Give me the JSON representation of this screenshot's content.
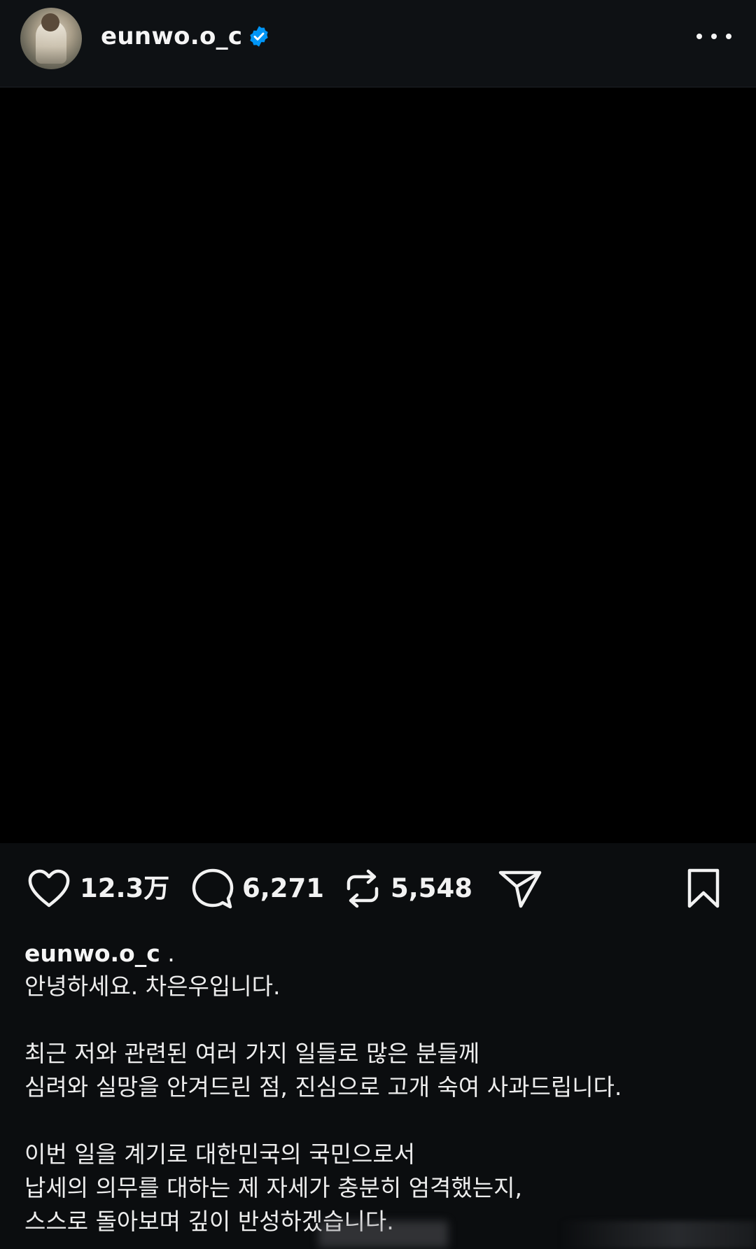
{
  "header": {
    "username": "eunwo.o_c",
    "verified": true,
    "more_icon": "more-horizontal-icon"
  },
  "media": {
    "background": "#000000"
  },
  "actions": {
    "like_count": "12.3万",
    "comment_count": "6,271",
    "repost_count": "5,548",
    "icons": [
      "heart-icon",
      "comment-icon",
      "repost-icon",
      "share-icon",
      "bookmark-icon"
    ]
  },
  "caption": {
    "username": "eunwo.o_c",
    "after_username": ".",
    "lines": [
      "안녕하세요. 차은우입니다.",
      "",
      "최근 저와 관련된 여러 가지 일들로 많은 분들께",
      "심려와 실망을 안겨드린 점, 진심으로 고개 숙여 사과드립니다.",
      "",
      "이번 일을 계기로 대한민국의 국민으로서",
      "납세의 의무를 대하는 제 자세가 충분히 엄격했는지,",
      "스스로 돌아보며 깊이 반성하겠습니다."
    ]
  },
  "colors": {
    "background": "#0b0d0f",
    "verified_blue": "#0095f6",
    "text": "#f2f2f2"
  }
}
